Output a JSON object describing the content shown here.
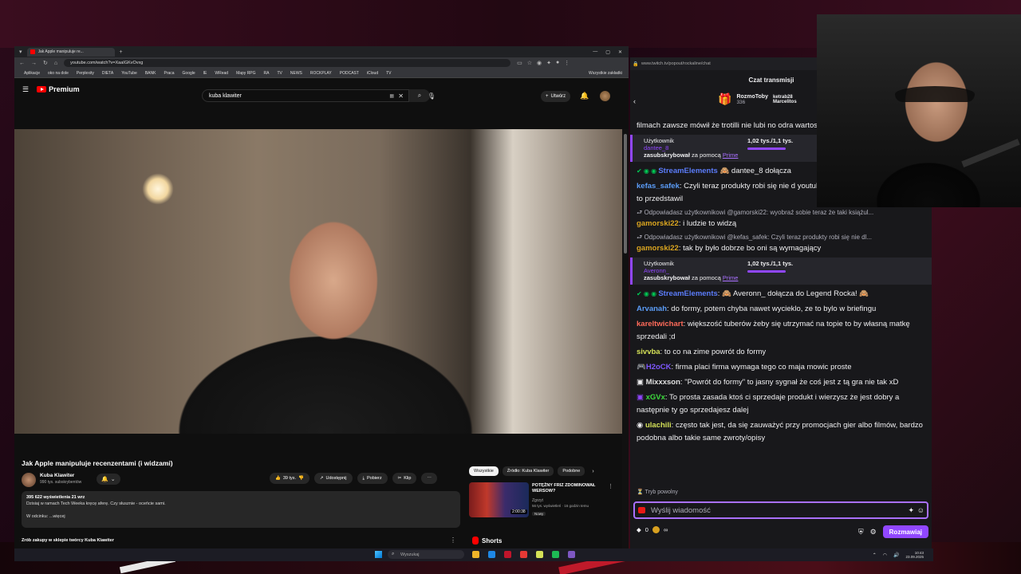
{
  "browser": {
    "tab_title": "Jak Apple manipuluje re...",
    "url": "youtube.com/watch?v=XaaIGKvOvxg",
    "bookmarks": [
      "Aplikacje",
      "oko na dole",
      "Perplexity",
      "DIETA",
      "YouTube",
      "BANK",
      "Praca",
      "Google",
      "IE",
      "WRead",
      "Mapy RPG",
      "RA",
      "TV",
      "NEWS",
      "ROCKPLAY",
      "PODCAST",
      "iCloud",
      "TV"
    ],
    "bookmarks_all": "Wszystkie zakładki"
  },
  "youtube": {
    "logo": "Premium",
    "search_value": "kuba klawiter",
    "create_label": "Utwórz",
    "video_title": "Jak Apple manipuluje recenzentami (i widzami)",
    "channel_name": "Kuba Klawiter",
    "channel_subs": "990 tys. subskrybentów",
    "likes": "39 tys.",
    "share": "Udostępnij",
    "download": "Pobierz",
    "clip": "Klip",
    "views": "395 622 wyświetlenia  21 wrz",
    "desc_line": "Dzisiaj w ramach Tech Weeka kręcę aferę. Czy słusznie - oceńcie sami.",
    "desc_more": "W odcinku:  ...więcej",
    "shop": "Zrób zakupy w sklepie twórcy Kuba Klawiter",
    "chips": [
      "Wszystkie",
      "Źródło: Kuba Klawiter",
      "Podobne"
    ],
    "rec_title": "POTĘŻNY FRIZ ZDOMINOWAŁ WERSOW?",
    "rec_channel": "Zgrzyt",
    "rec_meta": "56 tys. wyświetleń · 16 godzin temu",
    "rec_badge": "Nowy",
    "rec_duration": "2:00:38",
    "shorts": "Shorts"
  },
  "taskbar": {
    "search_placeholder": "Wyszukaj",
    "time": "10:43",
    "date": "23.09.2025"
  },
  "chat": {
    "url": "www.twitch.tv/popout/rockaline/chat",
    "title": "Czat transmisji",
    "leader_name": "RozmoToby",
    "leader_score": "336",
    "leader_2": "ketrab28",
    "leader_3": "Marcelitos",
    "messages": [
      {
        "user": "",
        "text": "filmach zawsze mówił że trotilli nie lubi no odra wartosci taka recenzja"
      },
      {
        "user": "StreamElements",
        "text": " dantee_8 dołącza"
      },
      {
        "user": "kefas_safek",
        "text": ": Czyli teraz produkty robi się nie d youtubera / influencera, zeby dobrze to przedstawil"
      },
      {
        "reply": "Odpowiadasz użytkownikowi @gamorski22: wyobraź sobie teraz że taki książul..."
      },
      {
        "user": "gamorski22",
        "text": ": i ludzie to widzą"
      },
      {
        "reply": "Odpowiadasz użytkownikowi @kefas_safek: Czyli teraz produkty robi się nie dl..."
      },
      {
        "user": "gamorski22",
        "text": ": tak by było dobrze bo oni są wymagający"
      },
      {
        "user": "StreamElements",
        "text": " Averonn_ dołącza do Legend Rocka!"
      },
      {
        "user": "Arvanah",
        "text": ": do formy, potem chyba nawet wycieklo, ze to bylo w briefingu"
      },
      {
        "user": "kareltwichart",
        "text": ": większość tuberów żeby się utrzymać na topie to by własną matkę sprzedali ;d"
      },
      {
        "user": "sivvba",
        "text": ": to co na zime powrót do formy"
      },
      {
        "user": "H2oCK",
        "text": ": firma placi firma wymaga tego co maja mowic proste"
      },
      {
        "user": "Mixxxson",
        "text": ": \"Powrót do formy\" to jasny sygnał że coś jest z tą gra nie tak xD"
      },
      {
        "user": "xGVx",
        "text": ": To prosta zasada ktoś ci sprzedaje produkt i wierzysz że jest dobry a następnie ty go sprzedajesz dalej"
      },
      {
        "user": "ulachili",
        "text": ": często tak jest, da się zauważyć przy promocjach gier albo filmów, bardzo podobna albo takie same zwroty/opisy"
      }
    ],
    "subs": [
      {
        "label": "Użytkownik",
        "name": "dantee_8",
        "action": "zasubskrybował",
        "via": "za pomocą",
        "prime": "Prime",
        "count": "1,02 tys./1,1 tys."
      },
      {
        "label": "Użytkownik",
        "name": "Averonn_",
        "action": "zasubskrybował",
        "via": "za pomocą",
        "prime": "Prime",
        "count": "1,02 tys./1,1 tys."
      }
    ],
    "slow_mode": "Tryb powolny",
    "input_placeholder": "Wyślij wiadomość",
    "points": "0",
    "infinity": "∞",
    "chat_button": "Rozmawiaj"
  },
  "colors": {
    "twitch_purple": "#9147ff",
    "youtube_red": "#ff0000"
  }
}
